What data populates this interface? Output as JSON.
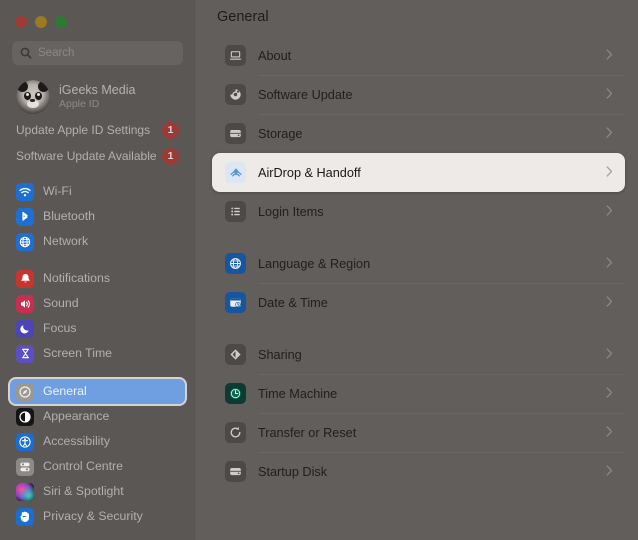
{
  "window": {
    "traffic_lights": [
      "close",
      "minimize",
      "maximize"
    ],
    "accent_color": "#6f9fe0",
    "badge_color": "#9d3a36",
    "sidebar_bg": "#5a5755",
    "content_bg": "#615e5c",
    "highlight_row_bg": "#edeae7"
  },
  "sidebar": {
    "search": {
      "placeholder": "Search",
      "value": "",
      "icon": "search-icon"
    },
    "account": {
      "name": "iGeeks Media",
      "subtitle": "Apple ID",
      "avatar": "panda-avatar"
    },
    "alerts": [
      {
        "label": "Update Apple ID Settings",
        "badge": "1"
      },
      {
        "label": "Software Update Available",
        "badge": "1"
      }
    ],
    "groups": [
      {
        "items": [
          {
            "label": "Wi-Fi",
            "icon": "wifi-icon",
            "selected": false
          },
          {
            "label": "Bluetooth",
            "icon": "bluetooth-icon",
            "selected": false
          },
          {
            "label": "Network",
            "icon": "network-icon",
            "selected": false
          }
        ]
      },
      {
        "items": [
          {
            "label": "Notifications",
            "icon": "notifications-icon",
            "selected": false
          },
          {
            "label": "Sound",
            "icon": "sound-icon",
            "selected": false
          },
          {
            "label": "Focus",
            "icon": "focus-icon",
            "selected": false
          },
          {
            "label": "Screen Time",
            "icon": "screen-time-icon",
            "selected": false
          }
        ]
      },
      {
        "items": [
          {
            "label": "General",
            "icon": "general-icon",
            "selected": true
          },
          {
            "label": "Appearance",
            "icon": "appearance-icon",
            "selected": false
          },
          {
            "label": "Accessibility",
            "icon": "accessibility-icon",
            "selected": false
          },
          {
            "label": "Control Centre",
            "icon": "control-centre-icon",
            "selected": false
          },
          {
            "label": "Siri & Spotlight",
            "icon": "siri-icon",
            "selected": false
          },
          {
            "label": "Privacy & Security",
            "icon": "privacy-icon",
            "selected": false
          }
        ]
      }
    ]
  },
  "main": {
    "title": "General",
    "groups": [
      {
        "rows": [
          {
            "label": "About",
            "icon": "about-icon",
            "chevron": "chevron-right-icon",
            "highlighted": false
          },
          {
            "label": "Software Update",
            "icon": "software-update-icon",
            "chevron": "chevron-right-icon",
            "highlighted": false
          },
          {
            "label": "Storage",
            "icon": "storage-icon",
            "chevron": "chevron-right-icon",
            "highlighted": false
          },
          {
            "label": "AirDrop & Handoff",
            "icon": "airdrop-icon",
            "chevron": "chevron-right-icon",
            "highlighted": true
          },
          {
            "label": "Login Items",
            "icon": "login-items-icon",
            "chevron": "chevron-right-icon",
            "highlighted": false
          }
        ]
      },
      {
        "rows": [
          {
            "label": "Language & Region",
            "icon": "language-region-icon",
            "chevron": "chevron-right-icon",
            "highlighted": false
          },
          {
            "label": "Date & Time",
            "icon": "date-time-icon",
            "chevron": "chevron-right-icon",
            "highlighted": false
          }
        ]
      },
      {
        "rows": [
          {
            "label": "Sharing",
            "icon": "sharing-icon",
            "chevron": "chevron-right-icon",
            "highlighted": false
          },
          {
            "label": "Time Machine",
            "icon": "time-machine-icon",
            "chevron": "chevron-right-icon",
            "highlighted": false
          },
          {
            "label": "Transfer or Reset",
            "icon": "transfer-reset-icon",
            "chevron": "chevron-right-icon",
            "highlighted": false
          },
          {
            "label": "Startup Disk",
            "icon": "startup-disk-icon",
            "chevron": "chevron-right-icon",
            "highlighted": false
          }
        ]
      }
    ]
  }
}
